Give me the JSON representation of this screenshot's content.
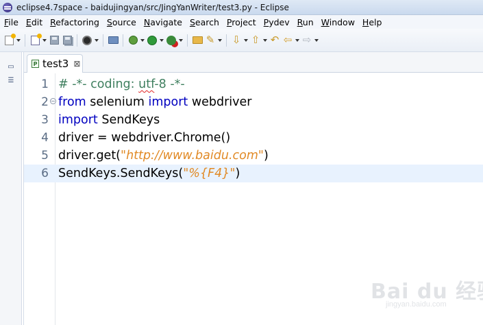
{
  "window": {
    "title": "eclipse4.7space - baidujingyan/src/JingYanWriter/test3.py - Eclipse"
  },
  "menu": {
    "items": [
      "File",
      "Edit",
      "Refactoring",
      "Source",
      "Navigate",
      "Search",
      "Project",
      "Pydev",
      "Run",
      "Window",
      "Help"
    ]
  },
  "toolbar": {
    "icons": [
      "new-icon",
      "new-wizard-icon",
      "save-icon",
      "save-all-icon",
      "console-icon",
      "open-type-icon",
      "debug-icon",
      "run-icon",
      "external-tools-icon",
      "open-folder-icon",
      "quick-access-icon",
      "next-annotation-icon",
      "previous-annotation-icon",
      "last-edit-icon",
      "back-icon",
      "forward-icon"
    ]
  },
  "editor": {
    "tab": {
      "label": "test3",
      "close": "⊠"
    },
    "current_line": 6,
    "lines": [
      {
        "number": "1",
        "parts": [
          {
            "type": "comment",
            "text": "# -*- coding: "
          },
          {
            "type": "comment-squiggle",
            "text": "utf"
          },
          {
            "type": "comment",
            "text": "-8 -*-"
          }
        ]
      },
      {
        "number": "2",
        "parts": [
          {
            "type": "keyword",
            "text": "from"
          },
          {
            "type": "plain",
            "text": " selenium "
          },
          {
            "type": "keyword",
            "text": "import"
          },
          {
            "type": "plain",
            "text": " webdriver"
          }
        ]
      },
      {
        "number": "3",
        "parts": [
          {
            "type": "keyword",
            "text": "import"
          },
          {
            "type": "plain",
            "text": " SendKeys"
          }
        ]
      },
      {
        "number": "4",
        "parts": [
          {
            "type": "plain",
            "text": "driver = webdriver.Chrome()"
          }
        ]
      },
      {
        "number": "5",
        "parts": [
          {
            "type": "plain",
            "text": "driver.get("
          },
          {
            "type": "string",
            "text": "\"http://www.baidu.com\""
          },
          {
            "type": "plain",
            "text": ")"
          }
        ]
      },
      {
        "number": "6",
        "parts": [
          {
            "type": "plain",
            "text": "SendKeys.SendKeys("
          },
          {
            "type": "string",
            "text": "\"%{F4}\""
          },
          {
            "type": "plain",
            "text": ")"
          }
        ]
      }
    ]
  },
  "watermark": {
    "text": "Bai du 经验",
    "sub": "jingyan.baidu.com"
  }
}
